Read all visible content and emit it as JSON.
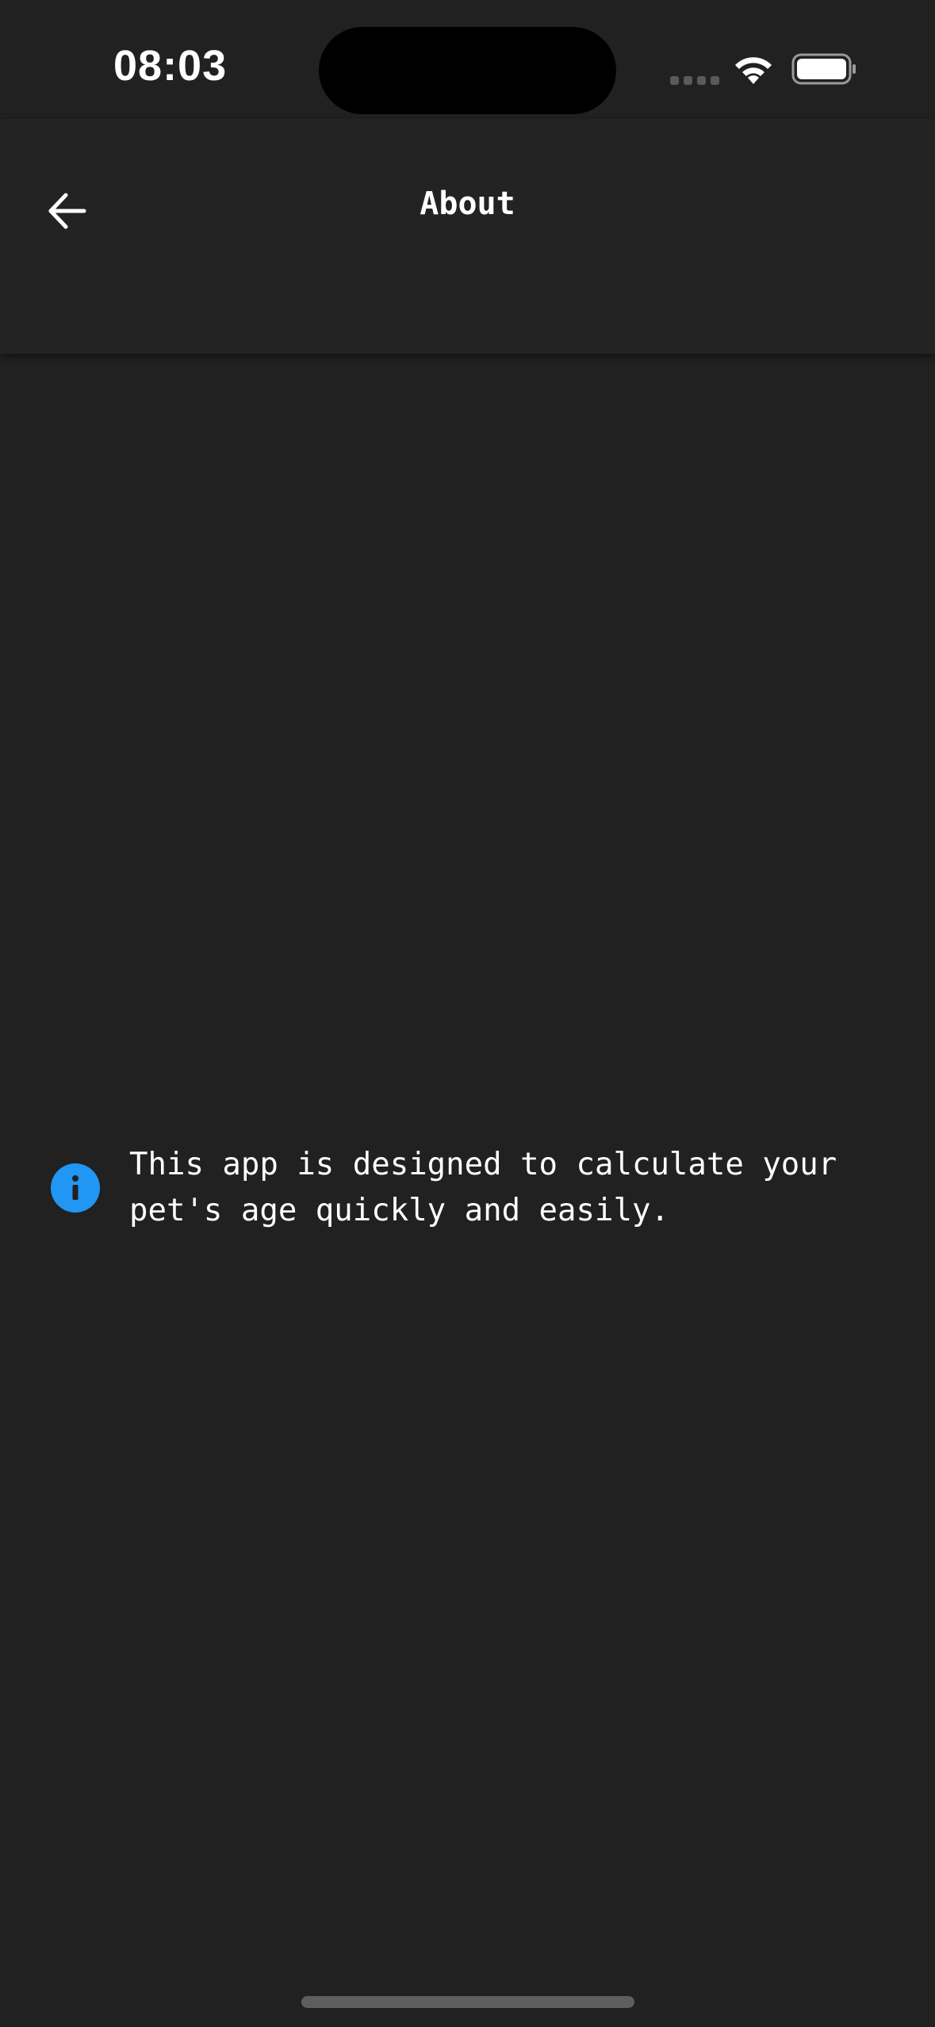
{
  "status_bar": {
    "time": "08:03",
    "icons": [
      "signal-icon",
      "wifi-icon",
      "battery-icon"
    ]
  },
  "app_bar": {
    "title": "About",
    "back_icon": "arrow-left-icon"
  },
  "info": {
    "icon": "info-icon",
    "icon_color": "#2196f3",
    "text": "This app is designed to calculate your\npet's age quickly and easily."
  },
  "colors": {
    "background": "#212121",
    "app_bar": "#232323",
    "text": "#ffffff"
  }
}
